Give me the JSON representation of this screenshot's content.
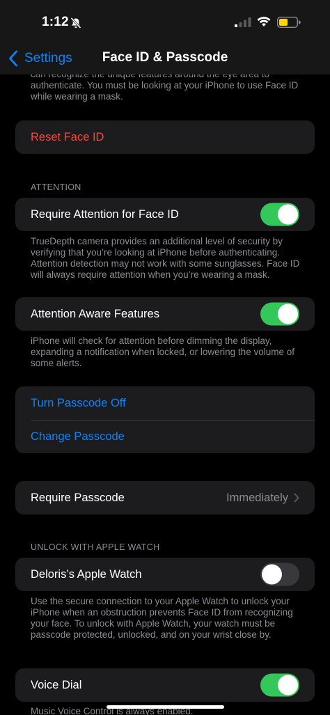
{
  "status_bar": {
    "time": "1:12"
  },
  "nav": {
    "back_label": "Settings",
    "title": "Face ID & Passcode"
  },
  "top_footnote": "can recognize the unique features around the eye area to authenticate. You must be looking at your iPhone to use Face ID while wearing a mask.",
  "reset_face_id": "Reset Face ID",
  "attention": {
    "header": "ATTENTION",
    "require_attention_label": "Require Attention for Face ID",
    "require_attention_on": true,
    "require_attention_footnote": "TrueDepth camera provides an additional level of security by verifying that you’re looking at iPhone before authenticating. Attention detection may not work with some sunglasses. Face ID will always require attention when you’re wearing a mask.",
    "aware_features_label": "Attention Aware Features",
    "aware_features_on": true,
    "aware_features_footnote": "iPhone will check for attention before dimming the display, expanding a notification when locked, or lowering the volume of some alerts."
  },
  "passcode": {
    "turn_off_label": "Turn Passcode Off",
    "change_label": "Change Passcode",
    "require_label": "Require Passcode",
    "require_value": "Immediately"
  },
  "apple_watch": {
    "header": "UNLOCK WITH APPLE WATCH",
    "watch_label": "Deloris’s Apple Watch",
    "watch_on": false,
    "footnote": "Use the secure connection to your Apple Watch to unlock your iPhone when an obstruction prevents Face ID from recognizing your face. To unlock with Apple Watch, your watch must be passcode protected, unlocked, and on your wrist close by."
  },
  "voice_dial": {
    "label": "Voice Dial",
    "on": true,
    "footnote": "Music Voice Control is always enabled."
  },
  "colors": {
    "accent_blue": "#0a84ff",
    "destructive_red": "#ff453a",
    "toggle_green": "#34c759",
    "battery_yellow": "#ffd60a"
  },
  "icons": [
    "bell-slash-icon",
    "cellular-signal-icon",
    "wifi-icon",
    "battery-icon",
    "chevron-left-icon",
    "chevron-right-icon"
  ]
}
